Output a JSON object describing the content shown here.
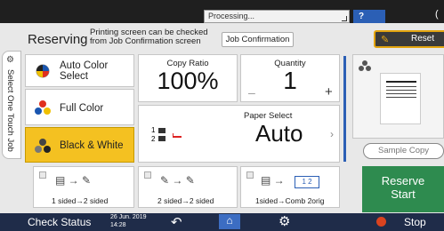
{
  "topbar": {
    "processing_label": "Processing...",
    "help_label": "?",
    "moon_label": "("
  },
  "header": {
    "title": "Reserving",
    "hint_line1": "Printing screen can be checked",
    "hint_line2": "from Job Confirmation screen",
    "job_confirmation_label": "Job Confirmation",
    "reset_label": "Reset"
  },
  "sidetab": {
    "label": "Select One Touch Job"
  },
  "color_options": [
    {
      "label_line1": "Auto Color",
      "label_line2": "Select"
    },
    {
      "label_line1": "Full Color",
      "label_line2": ""
    },
    {
      "label_line1": "Black & White",
      "label_line2": ""
    }
  ],
  "copy_ratio": {
    "label": "Copy Ratio",
    "value": "100%"
  },
  "quantity": {
    "label": "Quantity",
    "value": "1",
    "minus": "–",
    "plus": "+"
  },
  "paper_select": {
    "label": "Paper Select",
    "value": "Auto",
    "tray1": "1",
    "tray2": "2"
  },
  "duplex_options": [
    {
      "label": "1 sided→2 sided",
      "right_icon_text": ""
    },
    {
      "label": "2 sided→2 sided",
      "right_icon_text": ""
    },
    {
      "label": "1sided→Comb 2orig",
      "right_icon_text": "1 2"
    }
  ],
  "right_panel": {
    "sample_copy_label": "Sample Copy",
    "reserve_line1": "Reserve",
    "reserve_line2": "Start"
  },
  "bottombar": {
    "check_status_label": "Check Status",
    "date_label": "26 Jun. 2019",
    "time_label": "14:28",
    "stop_label": "Stop"
  }
}
